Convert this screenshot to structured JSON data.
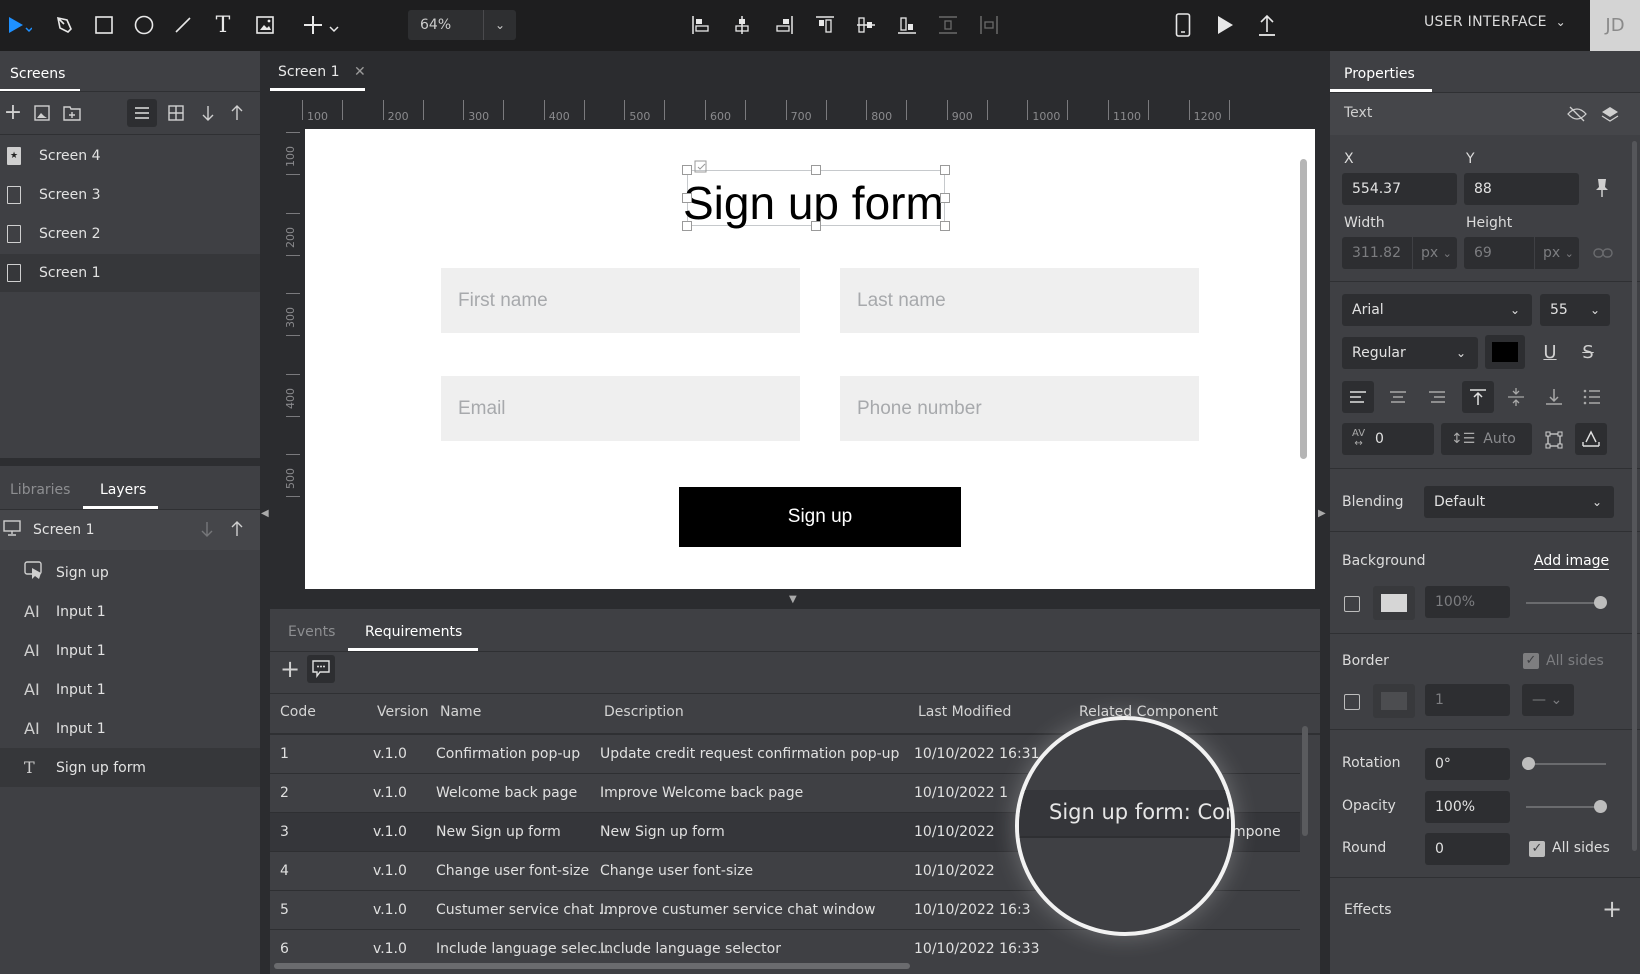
{
  "toolbar": {
    "tools": [
      "select-tool",
      "pen-tool",
      "rectangle-tool",
      "ellipse-tool",
      "line-tool",
      "text-tool",
      "image-tool",
      "add-tool"
    ],
    "zoom": "64%",
    "align_tools": [
      "align-left",
      "align-center-h",
      "align-right",
      "align-top",
      "align-center-v",
      "align-bottom",
      "distribute-v",
      "distribute-h"
    ],
    "project_menu": "USER INTERFACE",
    "avatar_initials": "JD",
    "accent": "#1e90ff"
  },
  "left_panel": {
    "tabs": {
      "screens": "Screens"
    },
    "screens": [
      {
        "label": "Screen 4",
        "icon": "starred-page-icon"
      },
      {
        "label": "Screen 3",
        "icon": "page-icon"
      },
      {
        "label": "Screen 2",
        "icon": "page-icon"
      },
      {
        "label": "Screen 1",
        "icon": "page-icon",
        "selected": true
      }
    ],
    "bottom_tabs": {
      "libraries": "Libraries",
      "layers": "Layers"
    },
    "layers_root": "Screen 1",
    "layers": [
      {
        "label": "Sign up",
        "icon": "button-layer-icon"
      },
      {
        "label": "Input 1",
        "icon": "input-layer-icon"
      },
      {
        "label": "Input 1",
        "icon": "input-layer-icon"
      },
      {
        "label": "Input 1",
        "icon": "input-layer-icon"
      },
      {
        "label": "Input 1",
        "icon": "input-layer-icon"
      },
      {
        "label": "Sign up form",
        "icon": "text-layer-icon",
        "selected": true
      }
    ]
  },
  "canvas": {
    "tab_label": "Screen 1",
    "ruler_h": [
      "100",
      "200",
      "300",
      "400",
      "500",
      "600",
      "700",
      "800",
      "900",
      "1000",
      "1100",
      "1200"
    ],
    "ruler_v": [
      "100",
      "200",
      "300",
      "400",
      "500"
    ],
    "form": {
      "title": "Sign up form",
      "first_name_placeholder": "First name",
      "last_name_placeholder": "Last name",
      "email_placeholder": "Email",
      "phone_placeholder": "Phone number",
      "submit_label": "Sign up"
    }
  },
  "bottom_panel": {
    "tabs": {
      "events": "Events",
      "requirements": "Requirements"
    },
    "columns": [
      "Code",
      "Version",
      "Name",
      "Description",
      "Last Modified",
      "Related Component"
    ],
    "rows": [
      {
        "code": "1",
        "version": "v.1.0",
        "name": "Confirmation pop-up",
        "description": "Update credit request confirmation pop-up",
        "modified": "10/10/2022 16:31",
        "component": ""
      },
      {
        "code": "2",
        "version": "v.1.0",
        "name": "Welcome back page",
        "description": "Improve Welcome back page",
        "modified": "10/10/2022 1",
        "component": ""
      },
      {
        "code": "3",
        "version": "v.1.0",
        "name": "New Sign up form",
        "description": "New Sign up form",
        "modified": "10/10/2022",
        "component": "Sign up form: Component"
      },
      {
        "code": "4",
        "version": "v.1.0",
        "name": "Change user font-size",
        "description": "Change user font-size",
        "modified": "10/10/2022",
        "component": ""
      },
      {
        "code": "5",
        "version": "v.1.0",
        "name": "Custumer service chat ...",
        "description": "Improve custumer service chat window",
        "modified": "10/10/2022 16:3",
        "component": ""
      },
      {
        "code": "6",
        "version": "v.1.0",
        "name": "Include language selec...",
        "description": "Include language selector",
        "modified": "10/10/2022 16:33",
        "component": ""
      }
    ],
    "magnifier_text": "Sign up form: Con",
    "magnifier_tail": "mpone"
  },
  "properties": {
    "tab": "Properties",
    "section": "Text",
    "x_label": "X",
    "x": "554.37",
    "y_label": "Y",
    "y": "88",
    "width_label": "Width",
    "width": "311.82",
    "width_unit": "px",
    "height_label": "Height",
    "height": "69",
    "height_unit": "px",
    "font": "Arial",
    "font_size": "55",
    "font_weight": "Regular",
    "text_color": "#000000",
    "letter_spacing": "0",
    "line_height": "Auto",
    "blending_label": "Blending",
    "blending": "Default",
    "background_label": "Background",
    "add_image": "Add image",
    "bg_opacity": "100%",
    "border_label": "Border",
    "border_all_sides": "All sides",
    "border_width": "1",
    "rotation_label": "Rotation",
    "rotation": "0°",
    "opacity_label": "Opacity",
    "opacity": "100%",
    "round_label": "Round",
    "round": "0",
    "round_all_sides": "All sides",
    "effects_label": "Effects",
    "opacity_fraction": 1.0,
    "rotation_fraction": 0.0
  }
}
